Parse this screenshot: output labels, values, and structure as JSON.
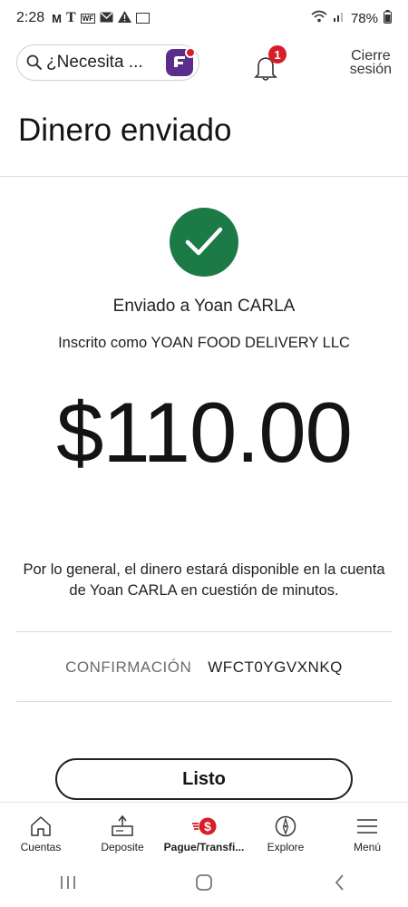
{
  "status_bar": {
    "time": "2:28",
    "battery": "78%",
    "left_icons": [
      "gmail-icon",
      "tmobile-icon",
      "wf-icon",
      "mail-icon",
      "warning-icon",
      "calendar-icon"
    ]
  },
  "header": {
    "search_placeholder": "¿Necesita ...",
    "notification_count": "1",
    "logout_line1": "Cierre",
    "logout_line2": "sesión"
  },
  "page": {
    "title": "Dinero enviado",
    "sent_to": "Enviado a Yoan CARLA",
    "enrolled_as": "Inscrito como YOAN FOOD DELIVERY LLC",
    "amount": "$110.00",
    "availability": "Por lo general, el dinero estará disponible en la cuenta de Yoan CARLA en cuestión de minutos.",
    "confirmation_label": "CONFIRMACIÓN",
    "confirmation_value": "WFCT0YGVXNKQ",
    "done_label": "Listo"
  },
  "bottom_nav": {
    "items": [
      {
        "label": "Cuentas",
        "icon": "home-icon"
      },
      {
        "label": "Deposite",
        "icon": "deposit-icon"
      },
      {
        "label": "Pague/Transfi...",
        "icon": "pay-transfer-icon",
        "active": true
      },
      {
        "label": "Explore",
        "icon": "compass-icon"
      },
      {
        "label": "Menú",
        "icon": "menu-icon"
      }
    ]
  },
  "colors": {
    "success_green": "#1c7a46",
    "brand_red": "#d71e28",
    "assistant_purple": "#5b2d8a"
  }
}
